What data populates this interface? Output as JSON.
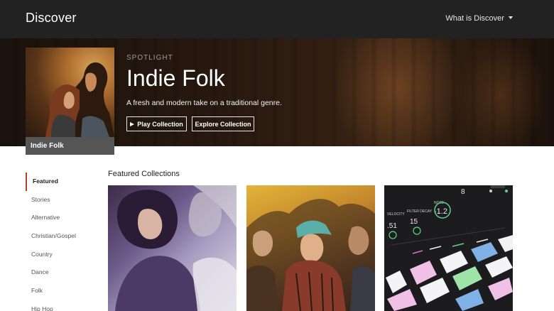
{
  "header": {
    "brand": "Discover",
    "nav_label": "What is Discover"
  },
  "hero": {
    "eyebrow": "SPOTLIGHT",
    "title": "Indie Folk",
    "description": "A fresh and modern take on a traditional genre.",
    "cover_label": "Indie Folk",
    "play_label": "Play Collection",
    "explore_label": "Explore Collection"
  },
  "sidebar": {
    "items": [
      {
        "label": "Featured",
        "active": true
      },
      {
        "label": "Stories"
      },
      {
        "label": "Alternative"
      },
      {
        "label": "Christian/Gospel"
      },
      {
        "label": "Country"
      },
      {
        "label": "Dance"
      },
      {
        "label": "Folk"
      },
      {
        "label": "Hip Hop"
      }
    ]
  },
  "featured": {
    "title": "Featured Collections",
    "tiles": [
      {
        "name": "collection-tile-1"
      },
      {
        "name": "collection-tile-2"
      },
      {
        "name": "collection-tile-3"
      }
    ]
  },
  "tile3_display": {
    "labels": [
      "VELOCITY",
      "FILTER DECAY",
      "NOTE"
    ],
    "values": [
      "-1.2",
      "8",
      ".51",
      "15"
    ]
  },
  "colors": {
    "header_bg": "#222222",
    "active_accent": "#c0392b",
    "cover_label_bg": "#555555"
  }
}
